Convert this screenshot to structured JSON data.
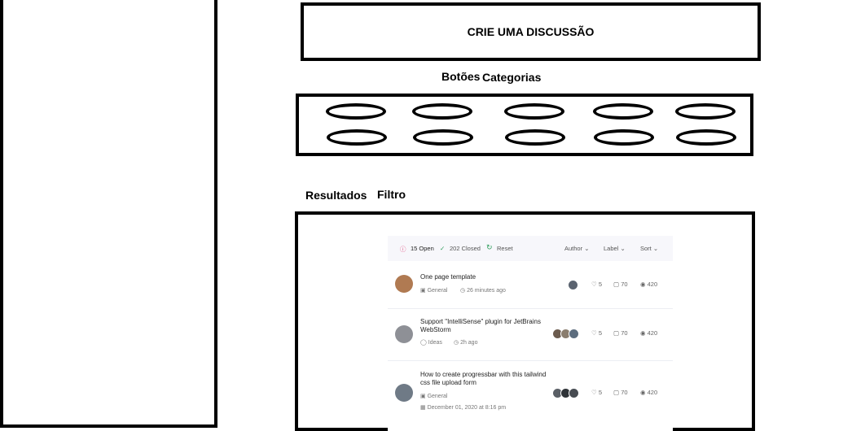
{
  "wireframe": {
    "create_discussion": "CRIE UMA DISCUSSÃO",
    "buttons_label": "Botões",
    "categories_label": "Categorias",
    "results_label": "Resultados",
    "filter_label": "Filtro"
  },
  "issues": {
    "toolbar": {
      "open": "15 Open",
      "closed": "202 Closed",
      "reset": "Reset",
      "author": "Author",
      "label": "Label",
      "sort": "Sort"
    },
    "rows": [
      {
        "title_line1": "One page template",
        "title_line2": "",
        "category": "General",
        "time": "26 minutes ago",
        "likes": "5",
        "comments": "70",
        "views": "420"
      },
      {
        "title_line1": "Support \"IntelliSense\" plugin for JetBrains",
        "title_line2": "WebStorm",
        "category": "Ideas",
        "time": "2h ago",
        "likes": "5",
        "comments": "70",
        "views": "420"
      },
      {
        "title_line1": "How to create progressbar with this tailwind",
        "title_line2": "css file upload form",
        "category": "General",
        "time": "December 01, 2020 at 8:16 pm",
        "likes": "5",
        "comments": "70",
        "views": "420"
      }
    ]
  },
  "colors": {
    "open_icon": "#e0457b",
    "closed_icon": "#2f9e5c",
    "reset_icon": "#2f9e5c",
    "toolbar_bg": "#f7f7fb"
  }
}
